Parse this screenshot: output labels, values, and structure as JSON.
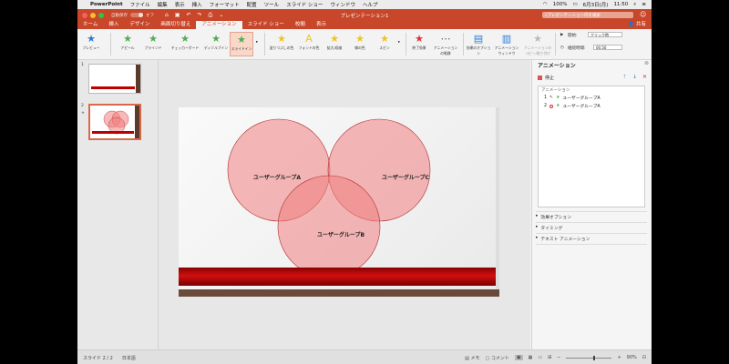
{
  "menubar": {
    "apple": "",
    "app_name": "PowerPoint",
    "items": [
      "ファイル",
      "編集",
      "表示",
      "挿入",
      "フォーマット",
      "配置",
      "ツール",
      "スライド ショー",
      "ウィンドウ",
      "ヘルプ"
    ],
    "battery": "100%",
    "date": "6月3日(月)",
    "time": "11:50"
  },
  "titlebar": {
    "autosave_label": "自動保存",
    "autosave_state": "オフ",
    "title": "プレゼンテーション1",
    "search_placeholder": "プレゼンテーション内を検索"
  },
  "tabs": [
    "ホーム",
    "挿入",
    "デザイン",
    "画面切り替え",
    "アニメーション",
    "スライド ショー",
    "校閲",
    "表示"
  ],
  "active_tab": "アニメーション",
  "share_label": "共有",
  "ribbon": {
    "preview_label": "プレビュー",
    "effects": [
      "アピール",
      "ブラインド",
      "チェッカーボード",
      "ディゾルブイン",
      "スライドイン"
    ],
    "emphasis": [
      "塗りつぶしの色",
      "フォントの色",
      "拡大/収縮",
      "線の色",
      "スピン"
    ],
    "exit_label": "終了効果",
    "path_label": "アニメーションの軌跡",
    "effect_options_label": "効果のオプション",
    "anim_window_label": "アニメーション ウィンドウ",
    "copy_anim_label": "アニメーションのコピー/貼り付け",
    "start_label": "開始:",
    "start_value": "クリック時",
    "duration_label": "継続時間:",
    "duration_value": "00.50"
  },
  "thumbnails": [
    {
      "number": "1"
    },
    {
      "number": "2",
      "star": "★"
    }
  ],
  "slide": {
    "labels": [
      "ユーザーグループA",
      "ユーザーグループB",
      "ユーザーグループC"
    ]
  },
  "pane": {
    "title": "アニメーション",
    "stop_label": "停止",
    "list_header": "アニメーション",
    "items": [
      {
        "index": "1",
        "label": "ユーザーグループA"
      },
      {
        "index": "2",
        "label": "ユーザーグループA"
      }
    ],
    "sections": [
      "効果オプション",
      "タイミング",
      "テキスト アニメーション"
    ]
  },
  "status": {
    "slide_info": "スライド 2 / 2",
    "language": "日本語",
    "notes": "メモ",
    "comments": "コメント",
    "zoom": "90%"
  },
  "colors": {
    "accent": "#c8462a",
    "circle_fill": "#f08080",
    "circle_stroke": "#b03030",
    "band": "#c00000"
  }
}
